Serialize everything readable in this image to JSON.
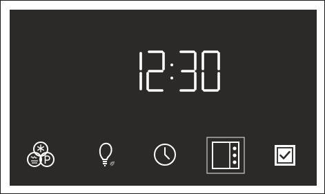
{
  "display": {
    "time": "12:30"
  },
  "icons": [
    {
      "name": "defrost-proof-mode-icon"
    },
    {
      "name": "oven-light-icon"
    },
    {
      "name": "clock-icon"
    },
    {
      "name": "menu-icon",
      "selected": true
    },
    {
      "name": "confirm-icon"
    }
  ],
  "colors": {
    "panel": "#2b2a29",
    "foreground": "#ffffff",
    "accent_leaf": "#8a8a8a"
  }
}
